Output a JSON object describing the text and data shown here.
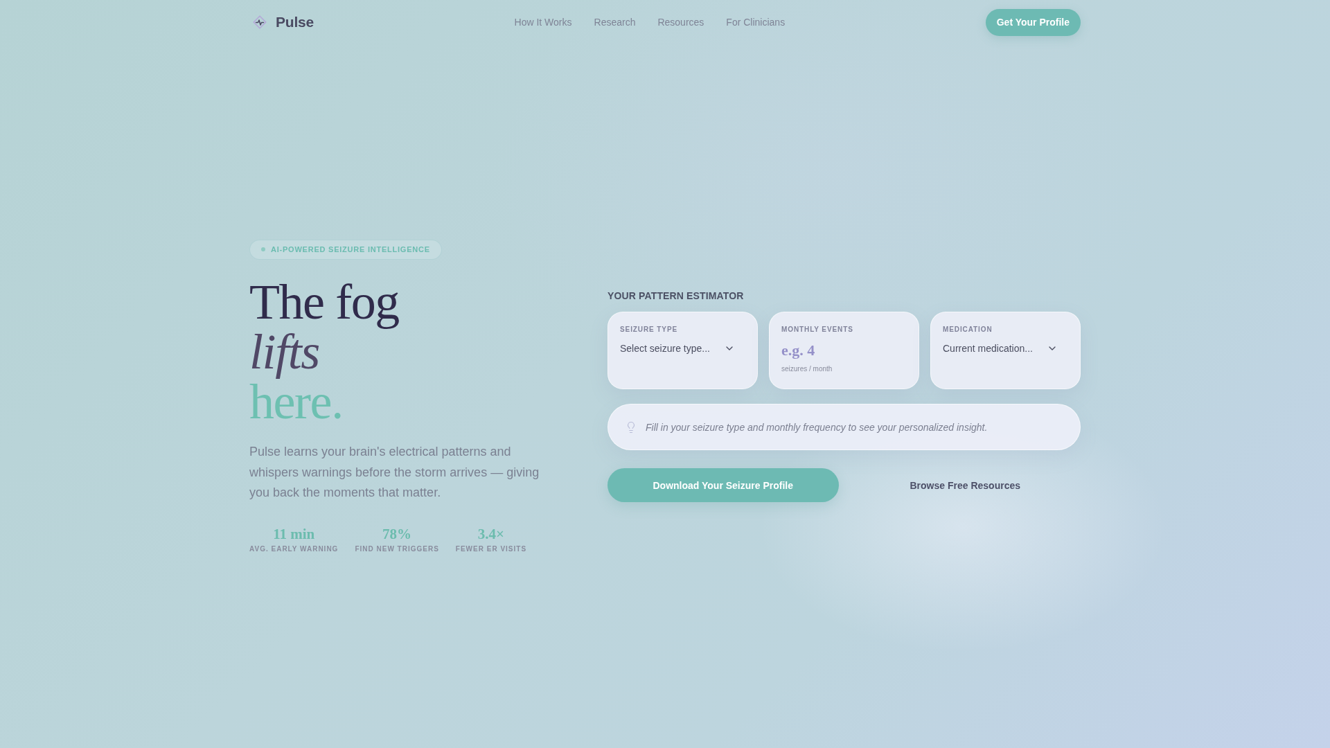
{
  "nav": {
    "brand": "Pulse",
    "links": [
      {
        "label": "How It Works"
      },
      {
        "label": "Research"
      },
      {
        "label": "Resources"
      },
      {
        "label": "For Clinicians"
      }
    ],
    "cta": "Get Your Profile"
  },
  "hero": {
    "badge": "AI-POWERED SEIZURE INTELLIGENCE",
    "headline": [
      {
        "text": "The fog",
        "kind": "plain"
      },
      {
        "text": "lifts",
        "kind": "italic"
      },
      {
        "text": "here.",
        "kind": "accent"
      }
    ],
    "lead": "Pulse learns your brain's electrical patterns and whispers warnings before the storm arrives — giving you back the moments that matter.",
    "stats": [
      {
        "value": "11 min",
        "label": "AVG. EARLY WARNING"
      },
      {
        "value": "78%",
        "label": "FIND NEW TRIGGERS"
      },
      {
        "value": "3.4×",
        "label": "FEWER ER VISITS"
      }
    ]
  },
  "estimator": {
    "title": "YOUR PATTERN ESTIMATOR",
    "fields": [
      {
        "kind": "select",
        "label": "SEIZURE TYPE",
        "value": "Select seizure type..."
      },
      {
        "kind": "number",
        "label": "MONTHLY EVENTS",
        "placeholder": "e.g. 4",
        "unit": "seizures / month"
      },
      {
        "kind": "select",
        "label": "MEDICATION",
        "value": "Current medication..."
      }
    ],
    "insight": "Fill in your seizure type and monthly frequency to see your personalized insight.",
    "buttons": [
      {
        "kind": "primary",
        "label": "Download Your Seizure Profile"
      },
      {
        "kind": "ghost",
        "label": "Browse Free Resources"
      }
    ]
  }
}
